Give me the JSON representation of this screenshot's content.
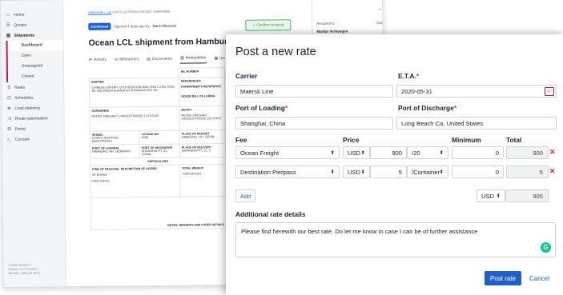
{
  "sidebar": {
    "items": [
      {
        "label": "Home",
        "icon": "home-icon"
      },
      {
        "label": "Quotes",
        "icon": "quote-icon"
      },
      {
        "label": "Shipments",
        "icon": "box-icon"
      }
    ],
    "sub_items": [
      "Dashboard",
      "Open",
      "Unassigned",
      "Closed"
    ],
    "items2": [
      {
        "label": "Rates",
        "icon": "dollar-icon"
      },
      {
        "label": "Schedules",
        "icon": "clock-icon"
      },
      {
        "label": "Load planning",
        "icon": "cube-icon"
      },
      {
        "label": "Route optimization",
        "icon": "route-icon"
      },
      {
        "label": "Portal",
        "icon": "portal-icon"
      },
      {
        "label": "Console",
        "icon": "console-icon"
      }
    ],
    "footer": [
      "© 2020 Shadi B.V.",
      "Version: 0.2.1-localDev",
      "Revision: (Obscuri iocet)"
    ]
  },
  "shipment": {
    "breadcrumb_link": "Shipments / Lub",
    "breadcrumb_rest": "/ 89f751d37f05f06f7f0f1f827 96f8f0f0f8f8",
    "status_badge": "Confirmed",
    "opened_text": "Opened 4 days ago by",
    "opened_by": "Harm Wessels",
    "confirm_received": "Confirm received",
    "title": "Ocean LCL shipment from Hamburg, HH to S",
    "tabs": [
      {
        "label": "Activity",
        "icon": "activity-icon"
      },
      {
        "label": "Milestones",
        "icon": "milestone-icon"
      },
      {
        "label": "Documents",
        "icon": "document-icon"
      },
      {
        "label": "Instructions",
        "icon": "instructions-icon"
      },
      {
        "label": "Inv",
        "icon": "invoice-icon"
      }
    ],
    "assigned_to_label": "Assigned to",
    "assigned_edit": "Edit",
    "assigned_name": "Martijn Verhoegen"
  },
  "bl": {
    "bl_number_label": "B/L NUMBER",
    "shipper_label": "SHIPPER",
    "shipper_value": "CHINESE EXPORT COOPERATION NAN JING LU BU XING JIE 456 345678 SHANGHAI SHANGHAI SHI CN",
    "references_label": "REFERENCES",
    "forwarders_ref_label": "FORWARDER'S REFERENCE",
    "house_bl_label": "HOUSE BILL OF LADING",
    "consignee_label": "CONSIGNEE",
    "consignee_value": "PETER ZWEGART LANGESTRASSE 123 KÖLN",
    "notify_label": "NOTIFY",
    "notify_value": "PETER ZWEGART LANGESTRASSE 123 KÖLN",
    "vessel_label": "VESSEL",
    "vessel_value": "COSCO SHIPPING SAGITTARIUS",
    "voyage_label": "VOYAGE NO.",
    "voyage_value": "006E",
    "receipt_label": "PLACE OF RECEIPT",
    "receipt_value": "HAMBURG, HH, GERM",
    "pol_label": "PORT OF LOADING",
    "pol_value": "HAMBURG, HH, GERMANY",
    "pod_label": "PORT OF DISCHARGE",
    "pod_value": "SHANGHAI PT, 31, CHINA",
    "delivery_label": "PLACE OF DELIVERY",
    "delivery_value": "SHANGHAI PT, 31, C",
    "particulars_label": "PARTICULARS",
    "package_label": "KIND OF PACKAGE, DESCRIPTION OF GOODS",
    "weight_label": "TOTAL WEIGHT",
    "package_value": "20 BOXES",
    "weight_value": "7,500.60 KGS",
    "goods_value": "CAR PARTS",
    "notes_label": "NOTES, REMARKS AND OTHER DETAILS"
  },
  "modal": {
    "title": "Post a new rate",
    "carrier_label": "Carrier",
    "carrier_value": "Maersk Line",
    "eta_label": "E.T.A.",
    "eta_value": "2020-05-31",
    "pol_label": "Port of Loading",
    "pol_value": "Shanghai, China",
    "pod_label": "Port of Discharge",
    "pod_value": "Long Beach Ca, United States",
    "col_fee": "Fee",
    "col_price": "Price",
    "col_minimum": "Minimum",
    "col_total": "Total",
    "rows": [
      {
        "fee": "Ocean Freight",
        "currency": "USD",
        "price": "900",
        "unit": "/20",
        "minimum": "0",
        "total": "900"
      },
      {
        "fee": "Destination Pierpass",
        "currency": "USD",
        "price": "5",
        "unit": "/Container",
        "minimum": "0",
        "total": "5"
      }
    ],
    "add_label": "Add",
    "sum_currency": "USD",
    "sum_total": "905",
    "details_label": "Additional rate details",
    "details_value": "Please find herewith our best rate. Do let me know in case I can be of further assistance",
    "post_label": "Post rate",
    "cancel_label": "Cancel"
  },
  "colors": {
    "accent": "#1f5fc7",
    "required": "#d32f2f",
    "brand": "#c2185b"
  }
}
